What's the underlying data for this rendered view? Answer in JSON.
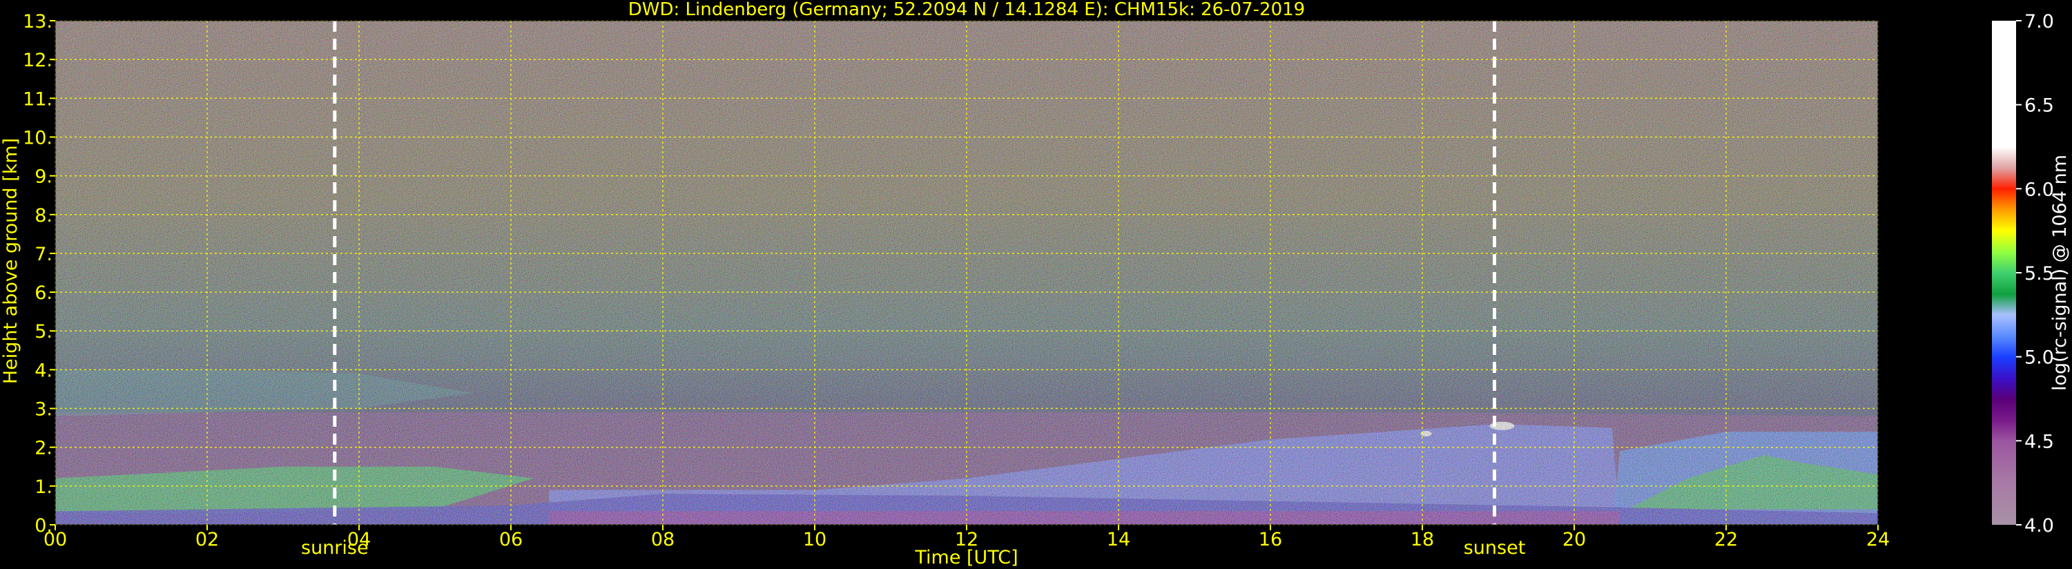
{
  "chart_data": {
    "type": "heatmap",
    "title": "DWD: Lindenberg (Germany; 52.2094 N / 14.1284 E):    CHM15k: 26-07-2019",
    "xlabel": "Time [UTC]",
    "ylabel": "Height above ground [km]",
    "xlim": [
      0,
      24
    ],
    "ylim": [
      0,
      13
    ],
    "x_ticks": [
      "00",
      "02",
      "04",
      "06",
      "08",
      "10",
      "12",
      "14",
      "16",
      "18",
      "20",
      "22",
      "24"
    ],
    "y_ticks": [
      "0.",
      "1.",
      "2.",
      "3.",
      "4.",
      "5.",
      "6.",
      "7.",
      "8.",
      "9.",
      "10.",
      "11.",
      "12.",
      "13."
    ],
    "grid": true,
    "markers": [
      {
        "label": "sunrise",
        "x": 3.68
      },
      {
        "label": "sunset",
        "x": 18.95
      }
    ],
    "colorbar": {
      "label": "log(rc-signal) @ 1064 nm",
      "min": 4.0,
      "max": 7.0,
      "ticks": [
        "4.0",
        "4.5",
        "5.0",
        "5.5",
        "6.0",
        "6.5",
        "7.0"
      ],
      "stops": [
        {
          "v": 4.0,
          "color": "#a892a6"
        },
        {
          "v": 4.25,
          "color": "#a87aa6"
        },
        {
          "v": 4.5,
          "color": "#9b55a0"
        },
        {
          "v": 4.62,
          "color": "#7a1a8a"
        },
        {
          "v": 4.75,
          "color": "#5a007a"
        },
        {
          "v": 4.87,
          "color": "#3a10c8"
        },
        {
          "v": 5.0,
          "color": "#1a40ff"
        },
        {
          "v": 5.12,
          "color": "#5a8aff"
        },
        {
          "v": 5.25,
          "color": "#a8c0ff"
        },
        {
          "v": 5.37,
          "color": "#10a040"
        },
        {
          "v": 5.5,
          "color": "#40d070"
        },
        {
          "v": 5.62,
          "color": "#90ff40"
        },
        {
          "v": 5.75,
          "color": "#ffff00"
        },
        {
          "v": 5.87,
          "color": "#ffa000"
        },
        {
          "v": 6.0,
          "color": "#ff2000"
        },
        {
          "v": 6.12,
          "color": "#e0a0a0"
        },
        {
          "v": 6.25,
          "color": "#ffffff"
        },
        {
          "v": 7.0,
          "color": "#ffffff"
        }
      ]
    },
    "colors": {
      "text": "#ffff00",
      "grid": "#ffff00",
      "background": "#000000",
      "marker": "#ffffff"
    }
  }
}
